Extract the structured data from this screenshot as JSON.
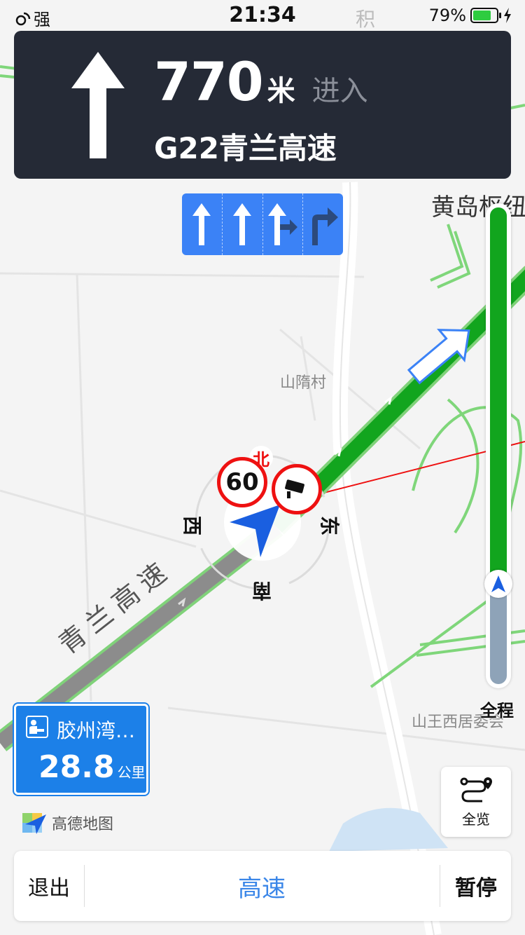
{
  "status_bar": {
    "signal": "强",
    "time": "21:34",
    "battery_percent": "79%",
    "battery_level": 0.79
  },
  "nav": {
    "distance": "770",
    "unit": "米",
    "action": "进入",
    "road": "G22青兰高速"
  },
  "lanes": [
    "straight",
    "straight",
    "straight-right",
    "right"
  ],
  "map": {
    "labels": {
      "huangdao": "黄岛枢纽",
      "ji": "积",
      "shansui": "山隋村",
      "shanwang": "山王西居委会",
      "highway": "青兰高速"
    },
    "speed_limit": "60",
    "compass": {
      "north": "北",
      "south": "南",
      "east": "东",
      "west": "西"
    }
  },
  "progress": {
    "label": "全程",
    "traveled_fraction": 0.79
  },
  "service_area": {
    "name": "胶州湾…",
    "distance": "28.8",
    "unit": "公里"
  },
  "logo": {
    "text": "高德地图"
  },
  "overview_button": {
    "label": "全览"
  },
  "bottom_bar": {
    "exit": "退出",
    "mode": "高速",
    "pause": "暂停"
  },
  "colors": {
    "route_green": "#12a51e",
    "card_dark": "#252a36",
    "lane_blue": "#3b82f6",
    "service_blue": "#1c80e8",
    "mode_blue": "#3a86e8"
  }
}
